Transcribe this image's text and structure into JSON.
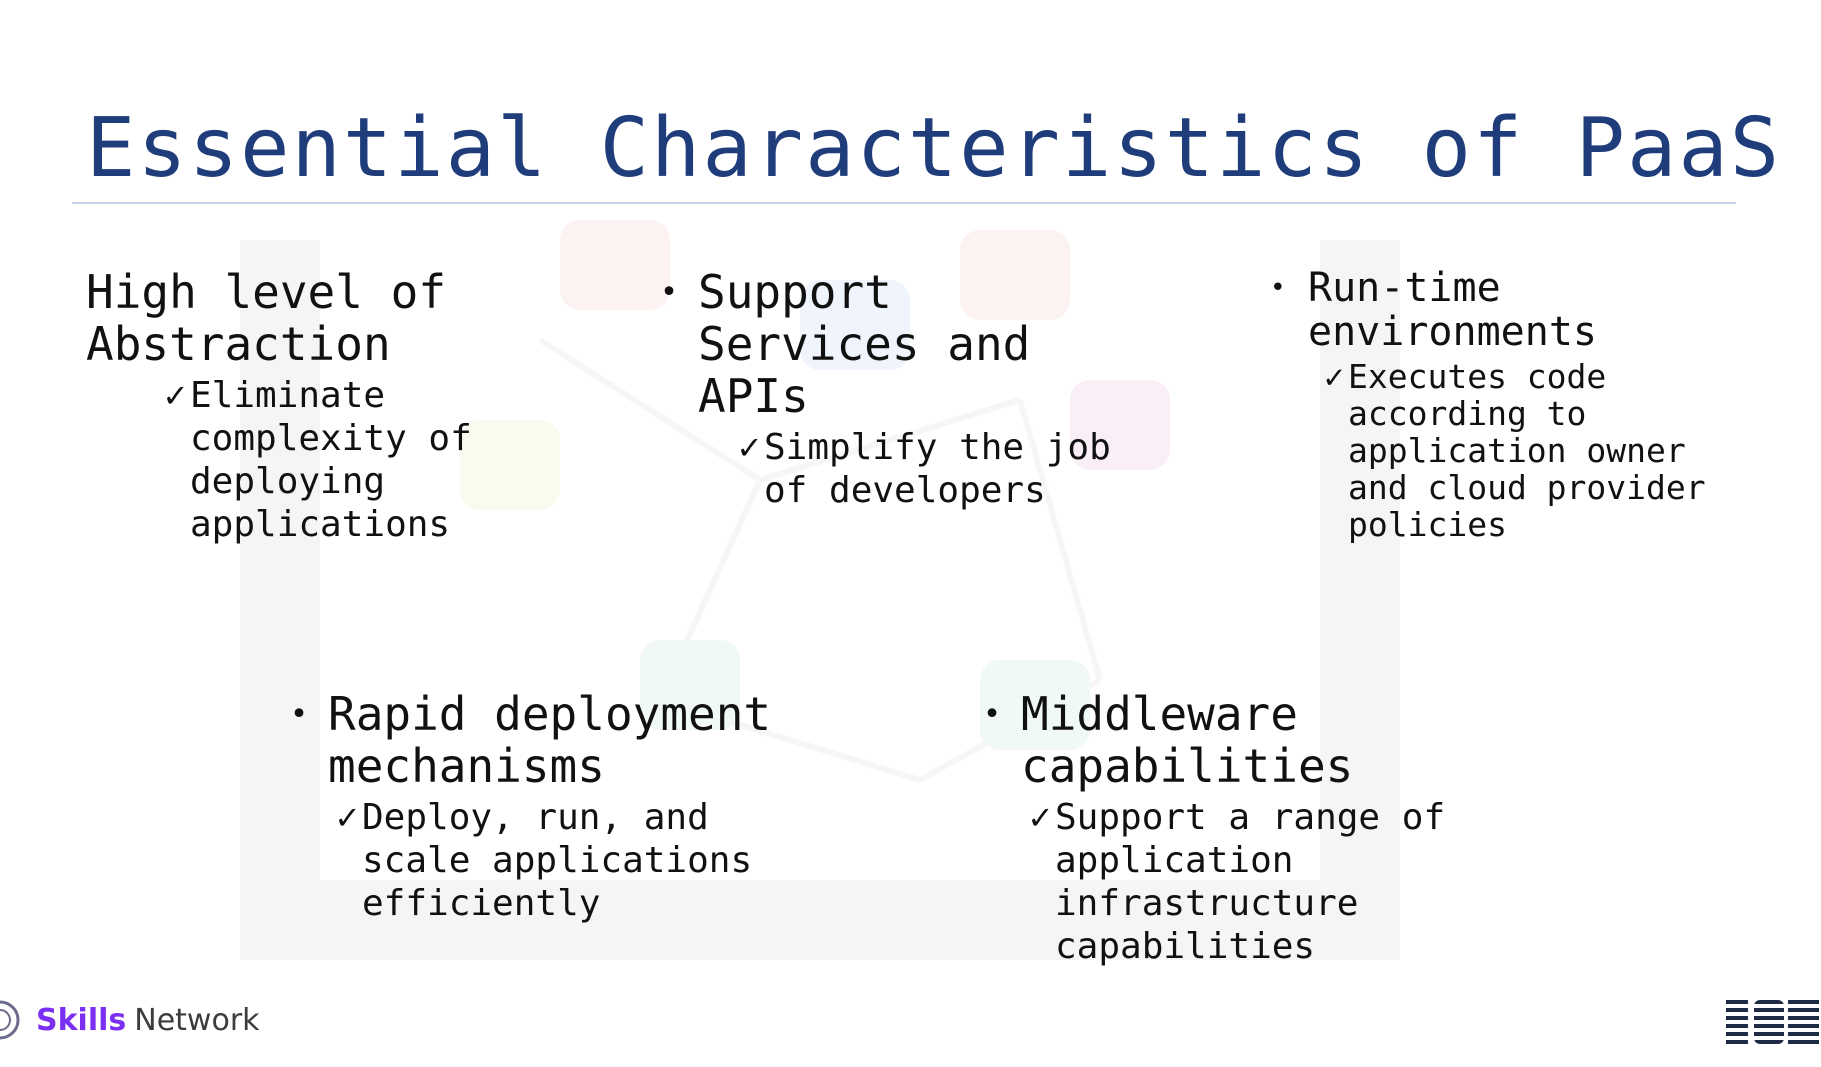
{
  "slide": {
    "title": "Essential Characteristics of PaaS",
    "items": [
      {
        "heading": "High level of\nAbstraction",
        "has_bullet": false,
        "detail": "Eliminate\ncomplexity of\ndeploying\napplications"
      },
      {
        "heading": "Support\nServices and\nAPIs",
        "has_bullet": true,
        "detail": "Simplify the job\nof developers"
      },
      {
        "heading": "Run-time\nenvironments",
        "has_bullet": true,
        "detail": "Executes code\naccording to\napplication owner\nand cloud provider\npolicies"
      },
      {
        "heading": "Rapid deployment\nmechanisms",
        "has_bullet": true,
        "detail": "Deploy, run, and\nscale applications\nefficiently"
      },
      {
        "heading": "Middleware\ncapabilities",
        "has_bullet": true,
        "detail": "Support a range of\napplication\ninfrastructure\ncapabilities"
      }
    ],
    "bullet_glyph": "•",
    "check_glyph": "✓"
  },
  "footer": {
    "brand_skills": "Skills",
    "brand_network": "Network",
    "partner_logo": "IBM"
  },
  "colors": {
    "title": "#1f3d7a",
    "skills": "#7b2ff2",
    "ibm": "#1f2a44"
  }
}
